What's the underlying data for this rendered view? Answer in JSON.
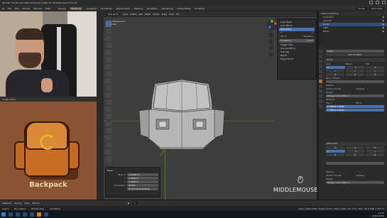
{
  "window": {
    "title": "Blender* [D:\\Dropbox\\Blender\\Projects\\Blender Mesh\\Backpack.blend]"
  },
  "topbar": {
    "menu": [
      "File",
      "Edit",
      "Render",
      "Window",
      "Help"
    ],
    "tabs": [
      "Layout",
      "Modeling",
      "Sculpting",
      "UV Editing",
      "Texture Paint",
      "Shading",
      "Animation",
      "Rendering",
      "Compositing",
      "Scripting"
    ],
    "active_tab": "Modeling",
    "scene_label": "Scene",
    "view_layer_label": "View Layer"
  },
  "reference": {
    "label": "Backpack",
    "header": "Image Editor"
  },
  "viewport": {
    "header_items": [
      "Edit Mode",
      "View",
      "Select",
      "Add",
      "Mesh",
      "Vertex",
      "Edge",
      "Face",
      "UV"
    ],
    "info_line1": "User Perspective",
    "info_line2": "(1) Cube",
    "overlay_text": "MIDDLEMOUSE"
  },
  "popup_menu": {
    "items": [
      "Loop Tools",
      "Auto Mirror",
      "Symmetry"
    ],
    "highlighted": "Symmetry",
    "fields": [
      {
        "label": "X",
        "value": "Y"
      },
      {
        "label": "Mirror",
        "value": "Negative"
      }
    ],
    "threshold_label": "Threshold",
    "threshold_value": "0.001",
    "options": [
      "Toggle Hide",
      "Cut and Mirror",
      "Use Clip",
      "Bisect",
      "Apply Mirror"
    ]
  },
  "operator_panel": {
    "title": "Move",
    "rows": [
      {
        "label": "Move X",
        "value": "-0.0482 m"
      },
      {
        "label": "Y",
        "value": "0.0000 m"
      },
      {
        "label": "Z",
        "value": "0.0000 m"
      },
      {
        "label": "Orientation",
        "value": "Global"
      },
      {
        "label": "",
        "value": "Proportional Editing"
      }
    ]
  },
  "outliner": {
    "header": "Scene Collection",
    "items": [
      "Collection",
      "Camera",
      "Cube",
      "Light",
      "Plane"
    ],
    "selected": "Cube"
  },
  "properties": {
    "object_name": "Cube",
    "modifier_section": "Add Modifier",
    "mirror": {
      "name": "Mirror",
      "axis_label": "Axis",
      "bisect_label": "Bisect",
      "flip_label": "Flip",
      "axes": [
        "X",
        "Y",
        "Z"
      ],
      "mirror_object_label": "Mirror Object",
      "options_label": "Options",
      "vertex_groups": "Vertex Groups",
      "clipping": "Clipping",
      "merge": "Merge",
      "merge_limit_label": "Merge Limit",
      "merge_limit_value": "0.001 m",
      "textures_label": "Textures",
      "flip_u": "Flip U",
      "flip_v": "Flip V",
      "u_offset_label": "U Offset",
      "u_offset_value": "0.0000",
      "v_offset_label": "V Offset",
      "v_offset_value": "0.0000"
    },
    "mirror2": {
      "name": "Mirror.001",
      "options_label": "Options",
      "vertex_groups": "Vertex Groups",
      "clipping": "Clipping",
      "merge": "Merge",
      "merge_limit_label": "Merge Limit",
      "merge_limit_value": "0.001 m"
    }
  },
  "timeline": {
    "items": [
      "Playback",
      "Keying",
      "View",
      "Marker"
    ],
    "current_frame": "1"
  },
  "statusbar": {
    "items": [
      "Select",
      "Box Select",
      "Rotate View",
      "Call Menu"
    ],
    "stats": "Cube | Verts 0/88 | Edges 0/172 | Faces 0/86 | Tris 172 | Mem: 29.6 MiB | 2.80.74"
  },
  "taskbar": {
    "time": "17:15",
    "date": "24/01/2020"
  },
  "colors": {
    "accent": "#4772b3",
    "active_tab": "#c46a2a",
    "viewport_bg": "#3d3d3d"
  }
}
